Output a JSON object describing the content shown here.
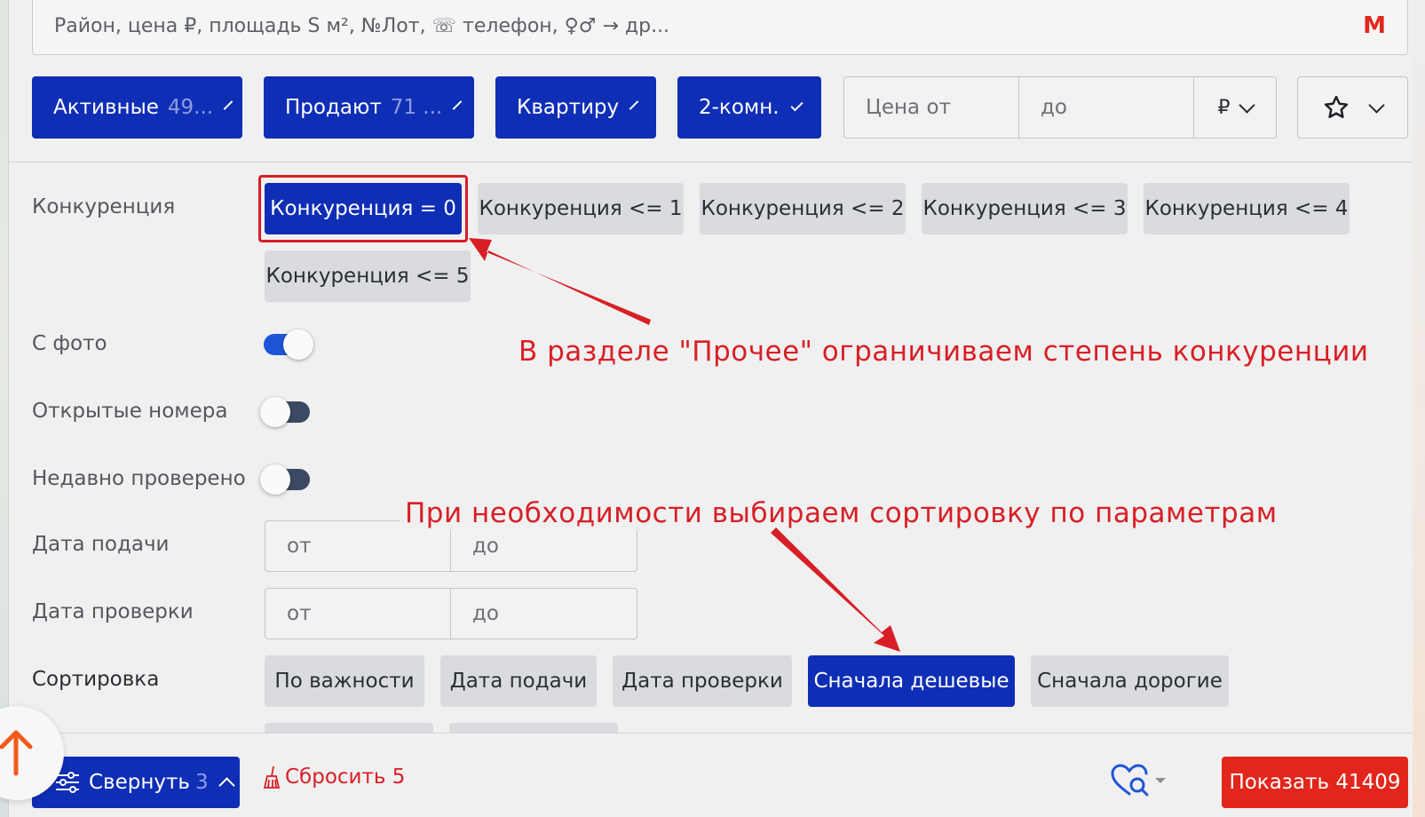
{
  "search": {
    "placeholder": "Район, цена ₽, площадь S м², №Лот, ☏ телефон, ♀♂ → др..."
  },
  "metro_icon": "М",
  "filters": [
    {
      "label": "Активные",
      "count": "49..."
    },
    {
      "label": "Продают",
      "count": "71 ..."
    },
    {
      "label": "Квартиру",
      "count": ""
    },
    {
      "label": "2-комн.",
      "count": ""
    }
  ],
  "price": {
    "from_placeholder": "Цена от",
    "to_placeholder": "до",
    "currency": "₽"
  },
  "competition": {
    "label": "Конкуренция",
    "options": [
      "Конкуренция = 0",
      "Конкуренция <= 1",
      "Конкуренция <= 2",
      "Конкуренция <= 3",
      "Конкуренция <= 4",
      "Конкуренция <= 5"
    ],
    "selected": 0
  },
  "toggles": [
    {
      "label": "С фото",
      "on": true
    },
    {
      "label": "Открытые номера",
      "on": false
    },
    {
      "label": "Недавно проверено",
      "on": false
    }
  ],
  "date_filed": {
    "label": "Дата подачи",
    "from": "от",
    "to": "до"
  },
  "date_checked": {
    "label": "Дата проверки",
    "from": "от",
    "to": "до"
  },
  "sorting": {
    "label": "Сортировка",
    "options": [
      "По важности",
      "Дата подачи",
      "Дата проверки",
      "Сначала дешевые",
      "Сначала дорогие"
    ],
    "selected": 3
  },
  "annotations": {
    "competition_note": "В разделе \"Прочее\" ограничиваем степень конкуренции",
    "sort_note": "При необходимости выбираем сортировку по параметрам"
  },
  "bottom": {
    "collapse_label": "Свернуть",
    "collapse_count": "3",
    "reset_label": "Сбросить 5",
    "show_label": "Показать 41409"
  },
  "colors": {
    "primary": "#0f2eb6",
    "accent_red": "#e3261b",
    "annotation_red": "#d81f26",
    "chip_bg": "#d9dbde"
  }
}
